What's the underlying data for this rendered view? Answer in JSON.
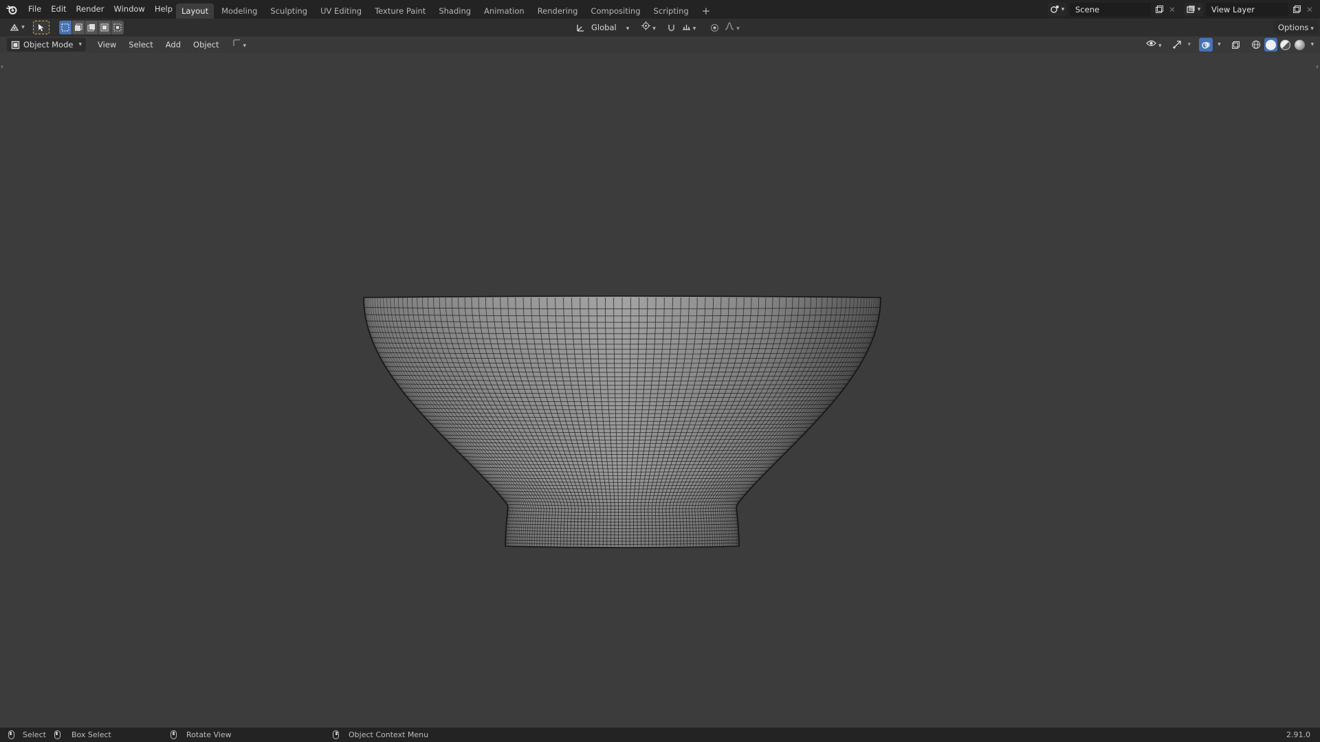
{
  "app": {
    "logo_icon": "blender-logo",
    "menus": [
      "File",
      "Edit",
      "Render",
      "Window",
      "Help"
    ],
    "workspaces": [
      "Layout",
      "Modeling",
      "Sculpting",
      "UV Editing",
      "Texture Paint",
      "Shading",
      "Animation",
      "Rendering",
      "Compositing",
      "Scripting"
    ],
    "active_workspace": "Layout",
    "add_workspace_icon": "plus-icon",
    "scene_label": "Scene",
    "view_layer_label": "View Layer"
  },
  "toolbar": {
    "transform_orientation": "Global",
    "options_label": "Options"
  },
  "header": {
    "mode": "Object Mode",
    "menus": [
      "View",
      "Select",
      "Add",
      "Object"
    ]
  },
  "viewport": {
    "object": "bowl",
    "display": "solid shading with wireframe overlay",
    "background_color": "#3c3c3c",
    "mesh_color": "#9a9a9a",
    "wire_color": "#111111"
  },
  "status": {
    "items": [
      {
        "icon": "mouse-left-icon",
        "label": "Select"
      },
      {
        "icon": "mouse-drag-icon",
        "label": "Box Select"
      },
      {
        "icon": "mouse-middle-icon",
        "label": "Rotate View"
      },
      {
        "icon": "mouse-right-icon",
        "label": "Object Context Menu"
      }
    ],
    "version": "2.91.0"
  },
  "colors": {
    "accent": "#4772b3",
    "topbar": "#232323",
    "panel": "#2e2e2e"
  }
}
